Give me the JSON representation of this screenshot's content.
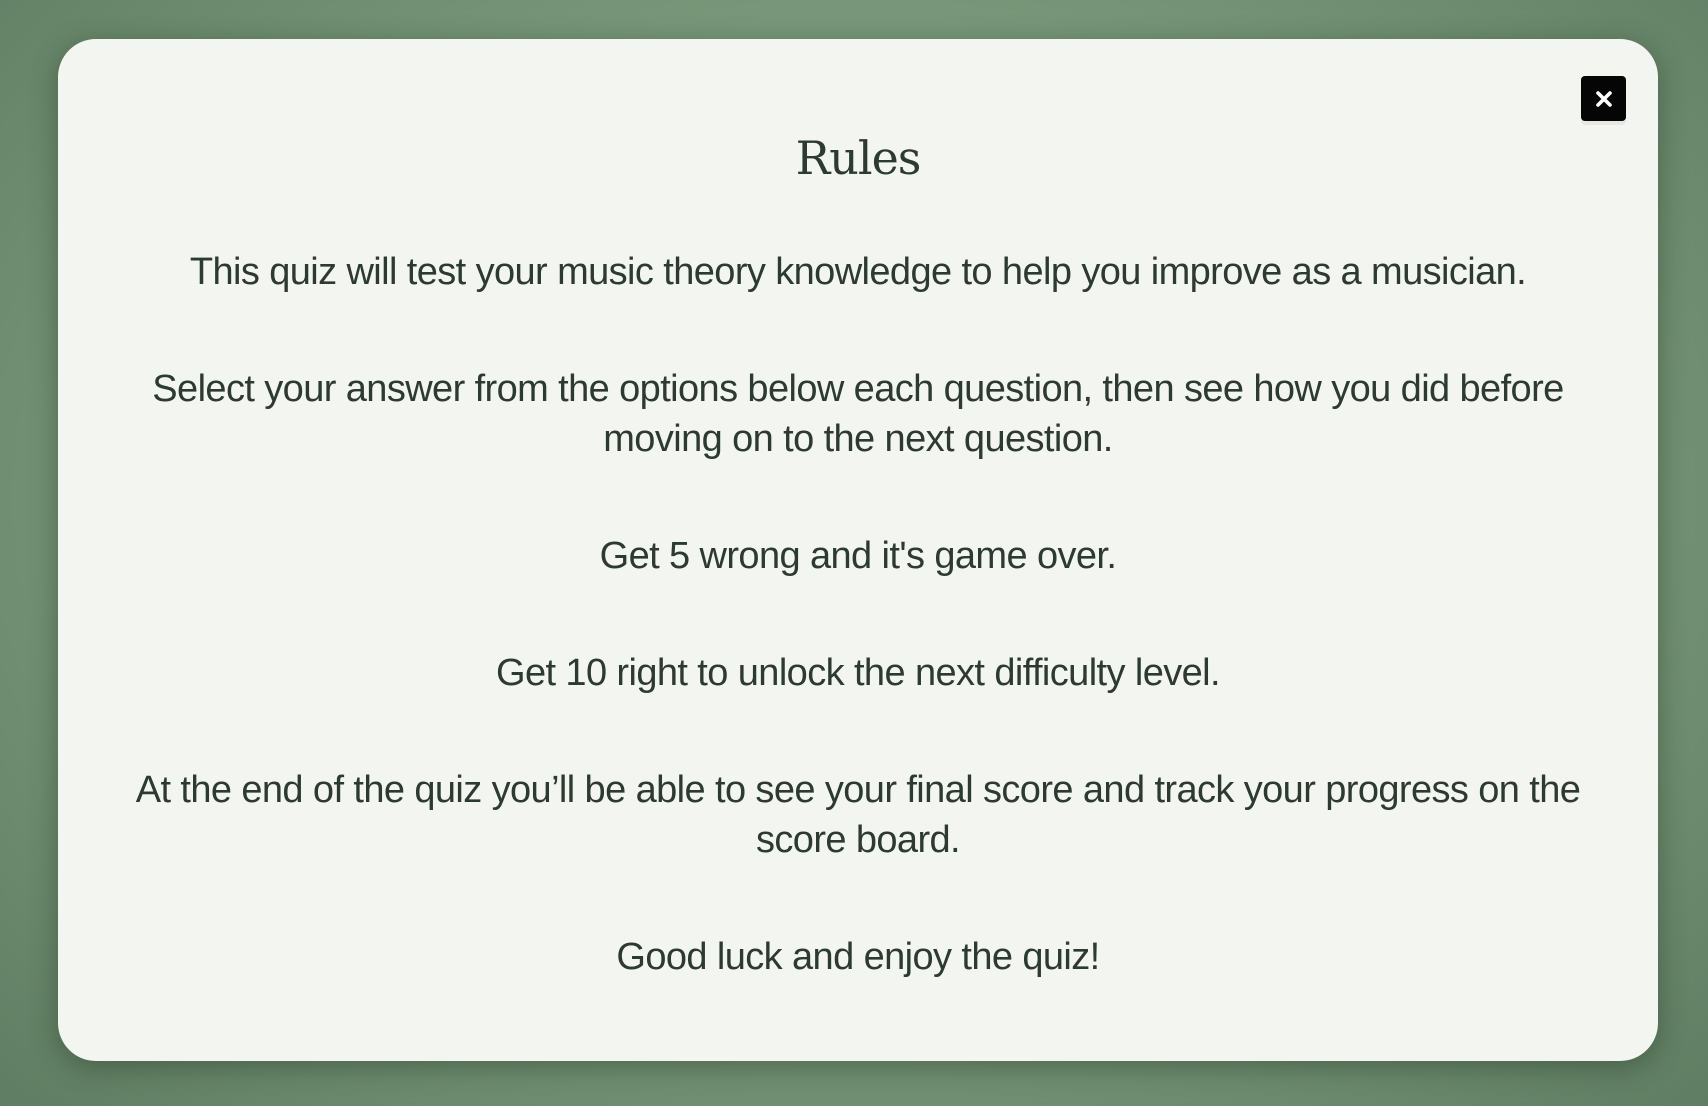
{
  "modal": {
    "title": "Rules",
    "close_icon": "close-icon",
    "paragraphs": [
      "This quiz will test your music theory knowledge to help you improve as a musician.",
      "Select your answer from the options below each question, then see how you did before moving on to the next question.",
      "Get 5 wrong and it's game over.",
      "Get 10 right to unlock the next difficulty level.",
      "At the end of the quiz you’ll be able to see your final score and track your progress on the score board.",
      "Good luck and enjoy the quiz!"
    ]
  },
  "colors": {
    "background": "#7f9e80",
    "modal_background": "#f3f5f0",
    "text": "#2c3a30",
    "close_button": "#050505"
  }
}
